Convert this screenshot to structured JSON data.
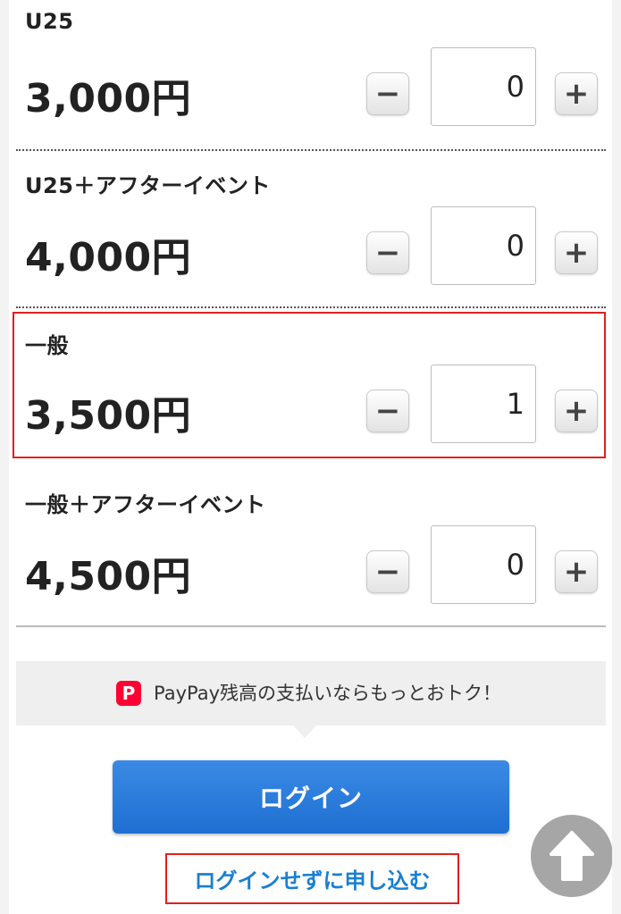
{
  "tickets": [
    {
      "name": "U25",
      "price": "3,000円",
      "quantity": "0",
      "minus": "−",
      "plus": "+"
    },
    {
      "name": "U25＋アフターイベント",
      "price": "4,000円",
      "quantity": "0",
      "minus": "−",
      "plus": "+"
    },
    {
      "name": "一般",
      "price": "3,500円",
      "quantity": "1",
      "minus": "−",
      "plus": "+"
    },
    {
      "name": "一般＋アフターイベント",
      "price": "4,500円",
      "quantity": "0",
      "minus": "−",
      "plus": "+"
    }
  ],
  "promo": {
    "logo": "P",
    "text": "PayPay残高の支払いならもっとおトク！"
  },
  "login_button": "ログイン",
  "guest_link": "ログインせずに申し込む",
  "scroll_top_icon": "arrow-up-icon",
  "colors": {
    "accent_blue": "#1f6fd3",
    "link_blue": "#1a7fd1",
    "highlight_red": "#e0201f",
    "paypay_red": "#ff0033"
  }
}
